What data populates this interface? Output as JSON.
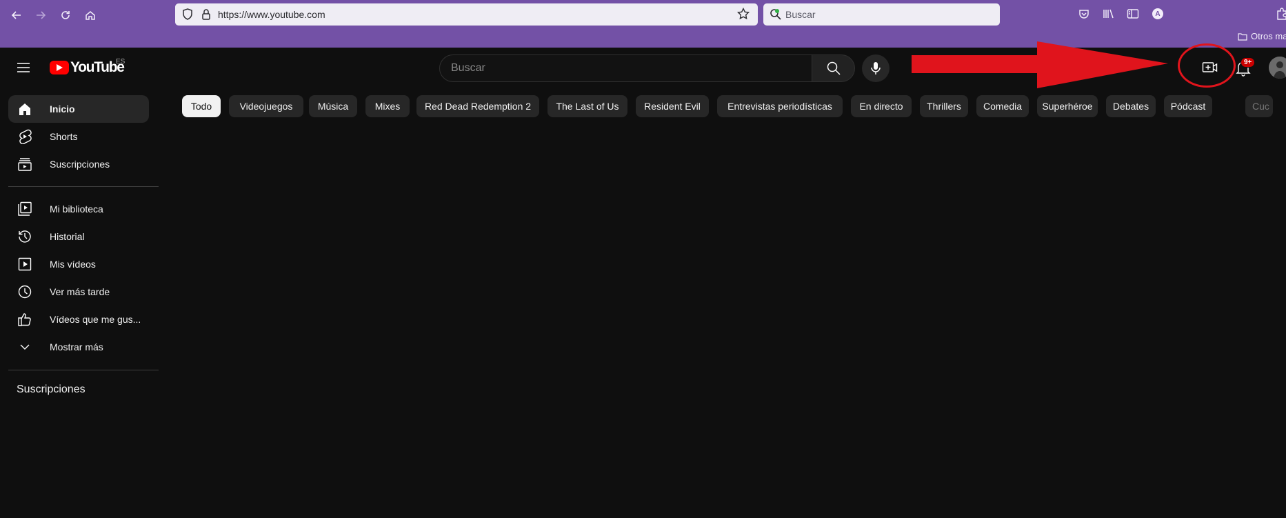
{
  "browser": {
    "url": "https://www.youtube.com",
    "search_placeholder": "Buscar",
    "account_initial": "A",
    "bookmarks_other": "Otros mar"
  },
  "header": {
    "logo_text": "YouTube",
    "region": "ES",
    "search_placeholder": "Buscar",
    "notification_badge": "9+"
  },
  "sidebar": {
    "items": [
      {
        "label": "Inicio",
        "icon": "home-icon",
        "active": true
      },
      {
        "label": "Shorts",
        "icon": "shorts-icon"
      },
      {
        "label": "Suscripciones",
        "icon": "subscriptions-icon"
      },
      {
        "label": "Mi biblioteca",
        "icon": "library-icon"
      },
      {
        "label": "Historial",
        "icon": "history-icon"
      },
      {
        "label": "Mis vídeos",
        "icon": "your-videos-icon"
      },
      {
        "label": "Ver más tarde",
        "icon": "watch-later-icon"
      },
      {
        "label": "Vídeos que me gus...",
        "icon": "liked-icon"
      },
      {
        "label": "Mostrar más",
        "icon": "chevron-down-icon"
      }
    ],
    "subscriptions_heading": "Suscripciones"
  },
  "chips": [
    "Todo",
    "Videojuegos",
    "Música",
    "Mixes",
    "Red Dead Redemption 2",
    "The Last of Us",
    "Resident Evil",
    "Entrevistas periodísticas",
    "En directo",
    "Thrillers",
    "Comedia",
    "Superhéroe",
    "Debates",
    "Pódcast",
    "Cuc"
  ],
  "colors": {
    "browser_accent": "#7351a6",
    "background": "#0f0f0f",
    "youtube_red": "#ff0000",
    "annotation_red": "#e0141c"
  }
}
